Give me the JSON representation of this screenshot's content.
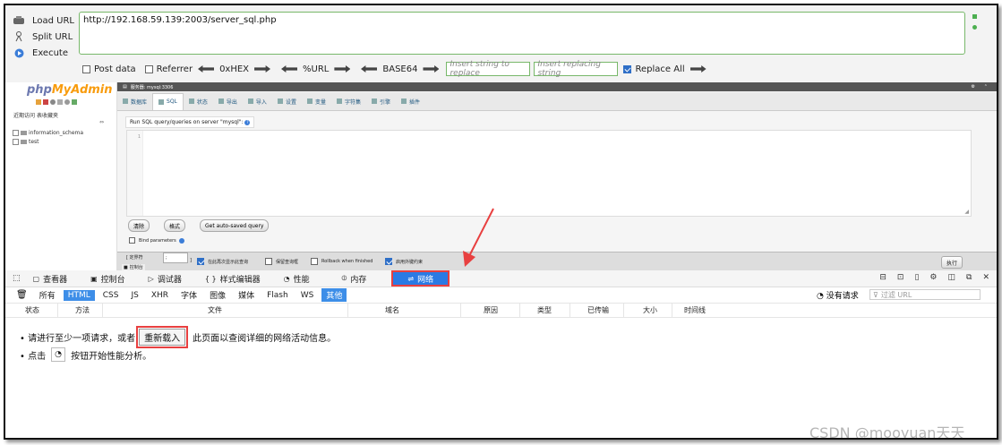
{
  "hackbar": {
    "commands": [
      "Load URL",
      "Split URL",
      "Execute"
    ],
    "url": "http://192.168.59.139:2003/server_sql.php",
    "options": {
      "post_data": "Post data",
      "referrer": "Referrer",
      "hex": "0xHEX",
      "url_enc": "%URL",
      "base64": "BASE64",
      "insert_placeholder": "Insert string to replace",
      "replacing_placeholder": "Insert replacing string",
      "replace_all": "Replace All"
    }
  },
  "pma": {
    "logo_a": "php",
    "logo_b": "MyAdmin",
    "left_links": [
      "近期访问",
      "表收藏夹"
    ],
    "databases": [
      "information_schema",
      "test"
    ],
    "server_bar": "服务器: mysql:3306",
    "tabs": [
      "数据库",
      "SQL",
      "状态",
      "导出",
      "导入",
      "设置",
      "变量",
      "字符集",
      "引擎",
      "插件"
    ],
    "query_label": "Run SQL query/queries on server \"mysql\":",
    "line_number": "1",
    "buttons": [
      "清除",
      "格式",
      "Get auto-saved query"
    ],
    "bind_params": "Bind parameters",
    "bottom": {
      "delimiter_label": "[ 定界符",
      "delimiter_value": ";",
      "bracket": "]",
      "show_again": "在此再次显示此查询",
      "retain_box": "保留查询框",
      "rollback": "Rollback when finished",
      "foreign_keys": "启用外键约束",
      "console": "控制台",
      "execute": "执行"
    }
  },
  "devtools": {
    "tabs": [
      "查看器",
      "控制台",
      "调试器",
      "样式编辑器",
      "性能",
      "内存",
      "网络"
    ],
    "filters": [
      "所有",
      "HTML",
      "CSS",
      "JS",
      "XHR",
      "字体",
      "图像",
      "媒体",
      "Flash",
      "WS",
      "其他"
    ],
    "no_request": "没有请求",
    "filter_url_placeholder": "过滤 URL",
    "columns": [
      "状态",
      "方法",
      "文件",
      "域名",
      "原因",
      "类型",
      "已传输",
      "大小",
      "时间线"
    ],
    "msg1_pre": "• 请进行至少一项请求，或者",
    "reload": "重新载入",
    "msg1_post": "此页面以查阅详细的网络活动信息。",
    "msg2_pre": "• 点击",
    "msg2_post": "按钮开始性能分析。"
  },
  "watermark": "CSDN @mooyuan天天",
  "colors": {
    "accent": "#2a7ae4",
    "highlight": "#e84040",
    "hackbar_border": "#78b86a"
  }
}
